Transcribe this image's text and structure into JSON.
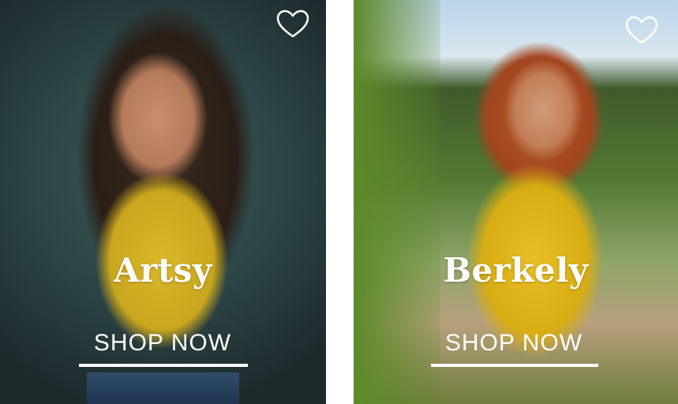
{
  "cards": [
    {
      "brand": "Artsy",
      "cta": "SHOP NOW",
      "favorite_icon": "heart-outline-icon"
    },
    {
      "brand": "Berkely",
      "cta": "SHOP NOW",
      "favorite_icon": "heart-outline-icon"
    }
  ],
  "colors": {
    "text": "#ffffff",
    "shirt_yellow": "#d8ad14"
  }
}
